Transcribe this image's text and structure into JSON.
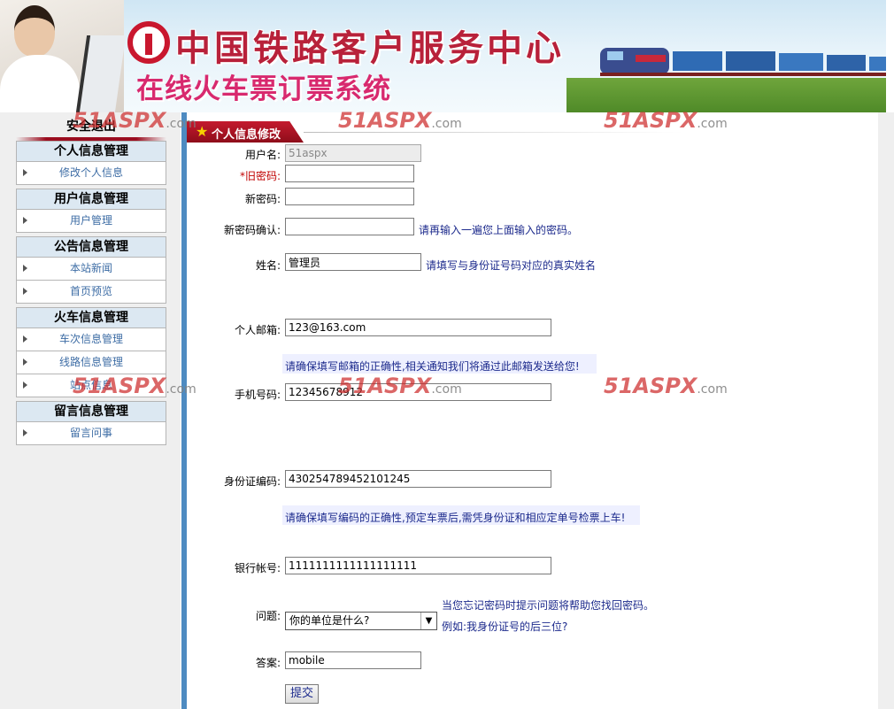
{
  "banner": {
    "title": "中国铁路客户服务中心",
    "subtitle": "在线火车票订票系统"
  },
  "sidebar": {
    "logout": "安全退出",
    "groups": [
      {
        "title": "个人信息管理",
        "items": [
          "修改个人信息"
        ]
      },
      {
        "title": "用户信息管理",
        "items": [
          "用户管理"
        ]
      },
      {
        "title": "公告信息管理",
        "items": [
          "本站新闻",
          "首页预览"
        ]
      },
      {
        "title": "火车信息管理",
        "items": [
          "车次信息管理",
          "线路信息管理",
          "站点信息"
        ]
      },
      {
        "title": "留言信息管理",
        "items": [
          "留言问事"
        ]
      }
    ]
  },
  "section": {
    "title": "个人信息修改"
  },
  "form": {
    "username": {
      "label": "用户名:",
      "value": "51aspx"
    },
    "old_password": {
      "label": "*旧密码:",
      "value": ""
    },
    "new_password": {
      "label": "新密码:",
      "value": ""
    },
    "confirm_password": {
      "label": "新密码确认:",
      "value": "",
      "hint": "请再输入一遍您上面输入的密码。"
    },
    "name": {
      "label": "姓名:",
      "value": "管理员",
      "hint": "请填写与身份证号码对应的真实姓名"
    },
    "email": {
      "label": "个人邮箱:",
      "value": "123@163.com",
      "hint": "请确保填写邮箱的正确性,相关通知我们将通过此邮箱发送给您!"
    },
    "phone": {
      "label": "手机号码:",
      "value": "12345678912"
    },
    "id_number": {
      "label": "身份证编码:",
      "value": "430254789452101245",
      "hint": "请确保填写编码的正确性,预定车票后,需凭身份证和相应定单号检票上车!"
    },
    "bank_account": {
      "label": "银行帐号:",
      "value": "1111111111111111111"
    },
    "question": {
      "label": "问题:",
      "selected": "你的单位是什么?",
      "hint1": "当您忘记密码时提示问题将帮助您找回密码。",
      "hint2": "例如:我身份证号的后三位?"
    },
    "answer": {
      "label": "答案:",
      "value": "mobile"
    },
    "submit": "提交"
  },
  "watermark": {
    "brand": "51ASPX",
    "suffix": ".com"
  },
  "colors": {
    "accent_blue": "#4e8bc1",
    "tab_red": "#c41a2e",
    "hint_blue": "#1c2a8c",
    "required_red": "#c00000"
  }
}
